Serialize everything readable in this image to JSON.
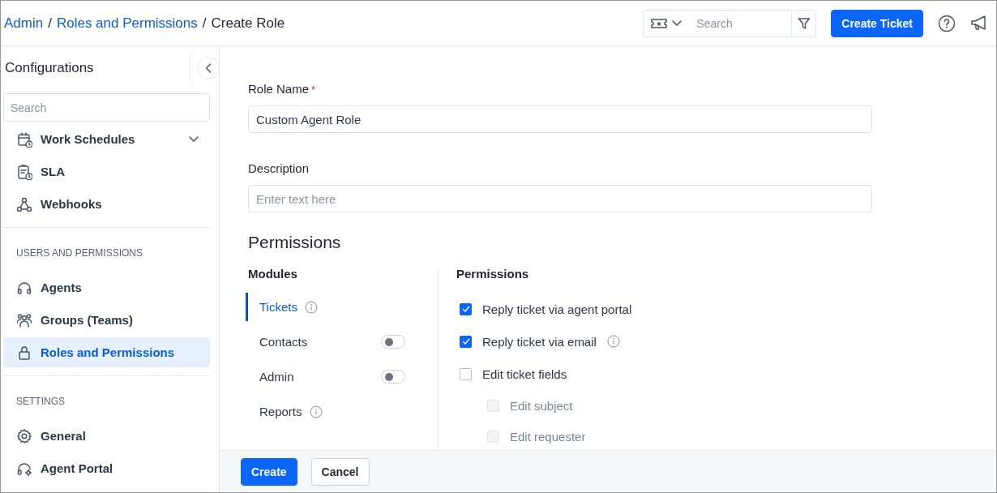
{
  "breadcrumb": [
    {
      "label": "Admin",
      "link": true
    },
    {
      "label": "Roles and Permissions",
      "link": true
    },
    {
      "label": "Create Role",
      "link": false
    }
  ],
  "breadcrumb_separator": "/",
  "header": {
    "search": {
      "placeholder": "Search"
    },
    "create_button": "Create Ticket"
  },
  "sidebar": {
    "title": "Configurations",
    "search": {
      "placeholder": "Search"
    },
    "sections": [
      {
        "items": [
          {
            "label": "Work Schedules",
            "selected": false,
            "expanded": false
          },
          {
            "label": "SLA",
            "selected": false
          },
          {
            "label": "Webhooks",
            "selected": false
          }
        ]
      },
      {
        "heading": "USERS AND PERMISSIONS",
        "items": [
          {
            "label": "Agents",
            "selected": false
          },
          {
            "label": "Groups (Teams)",
            "selected": false
          },
          {
            "label": "Roles and Permissions",
            "selected": true
          }
        ]
      },
      {
        "heading": "SETTINGS",
        "items": [
          {
            "label": "General",
            "selected": false
          },
          {
            "label": "Agent Portal",
            "selected": false
          }
        ]
      }
    ]
  },
  "form": {
    "role_name": {
      "label": "Role Name",
      "required": true,
      "required_mark": "*",
      "value": "Custom Agent Role"
    },
    "description": {
      "label": "Description",
      "placeholder": "Enter text here"
    },
    "permissions_title": "Permissions",
    "modules_heading": "Modules",
    "modules": [
      {
        "label": "Tickets",
        "selected": true,
        "kind": "info"
      },
      {
        "label": "Contacts",
        "selected": false,
        "kind": "toggle",
        "on": false
      },
      {
        "label": "Admin",
        "selected": false,
        "kind": "toggle",
        "on": false
      },
      {
        "label": "Reports",
        "selected": false,
        "kind": "info"
      }
    ],
    "permissions_heading": "Permissions",
    "permissions": [
      {
        "label": "Reply ticket via agent portal",
        "checked": true,
        "disabled": false,
        "info": false
      },
      {
        "label": "Reply ticket via email",
        "checked": true,
        "disabled": false,
        "info": true
      },
      {
        "label": "Edit ticket fields",
        "checked": false,
        "disabled": false,
        "info": false,
        "children": [
          {
            "label": "Edit subject",
            "checked": false,
            "disabled": true,
            "info": false
          },
          {
            "label": "Edit requester",
            "checked": false,
            "disabled": true,
            "info": false
          }
        ]
      }
    ]
  },
  "footer": {
    "buttons": [
      {
        "label": "Create",
        "kind": "primary"
      },
      {
        "label": "Cancel",
        "kind": "secondary"
      }
    ]
  }
}
